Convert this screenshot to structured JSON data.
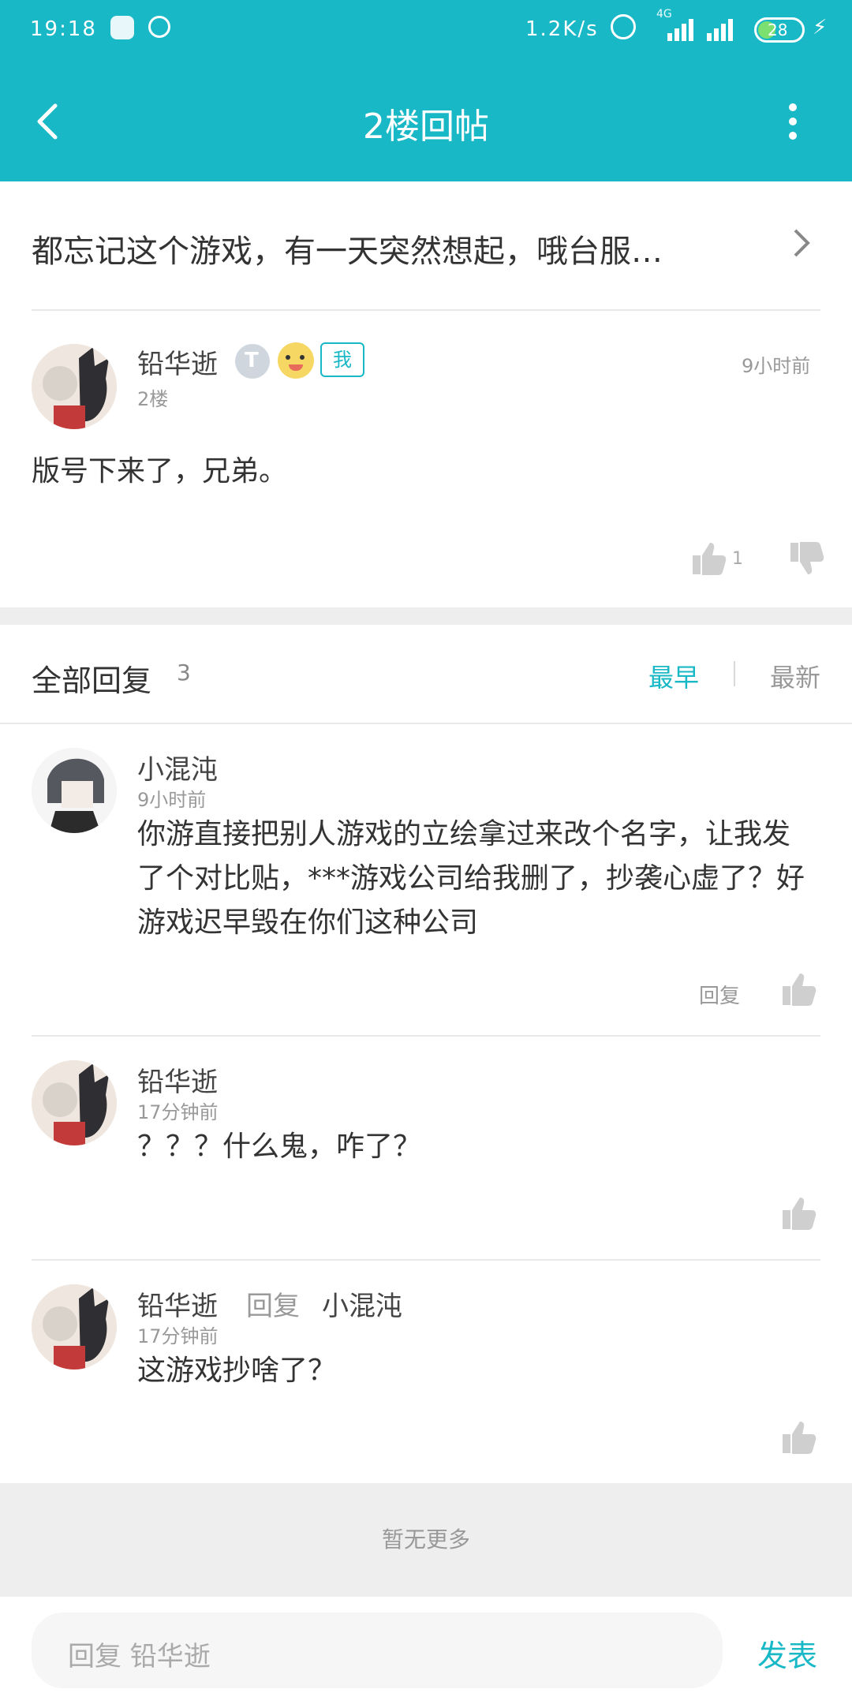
{
  "status_bar": {
    "time": "19:18",
    "network_speed": "1.2K/s",
    "network_type": "4G",
    "battery": "28"
  },
  "header": {
    "title": "2楼回帖"
  },
  "thread": {
    "title": "都忘记这个游戏，有一天突然想起，哦台服…"
  },
  "post": {
    "author": "铅华逝",
    "badge_text": "我",
    "floor": "2楼",
    "time": "9小时前",
    "content": "版号下来了，兄弟。",
    "like_count": "1"
  },
  "replies_header": {
    "label": "全部回复",
    "count": "3",
    "sort_earliest": "最早",
    "sort_latest": "最新"
  },
  "replies": [
    {
      "author": "小混沌",
      "time": "9小时前",
      "content": "你游直接把别人游戏的立绘拿过来改个名字，让我发了个对比贴，***游戏公司给我删了，抄袭心虚了？好游戏迟早毁在你们这种公司",
      "reply_label": "回复"
    },
    {
      "author": "铅华逝",
      "time": "17分钟前",
      "content": "？？？什么鬼，咋了？"
    },
    {
      "author": "铅华逝",
      "reply_word": "回复",
      "reply_to": "小混沌",
      "time": "17分钟前",
      "content": "这游戏抄啥了？"
    }
  ],
  "no_more": "暂无更多",
  "composer": {
    "placeholder": "回复 铅华逝",
    "send_label": "发表"
  },
  "colors": {
    "accent": "#19b8c6",
    "divider": "#e8e8e8"
  }
}
